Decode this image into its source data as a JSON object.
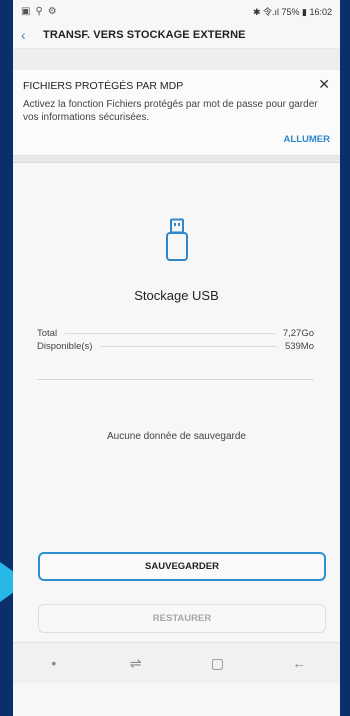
{
  "statusbar": {
    "left_icons": [
      "image-icon",
      "usb-icon",
      "network-icon"
    ],
    "right_text": "✱ 令.ıl 75% ▮ 16:02"
  },
  "appbar": {
    "title": "TRANSF. VERS STOCKAGE EXTERNE"
  },
  "notice_card": {
    "title": "FICHIERS PROTÉGÉS PAR MDP",
    "body": "Activez la fonction Fichiers protégés par mot de passe pour garder vos informations sécurisées.",
    "action": "ALLUMER"
  },
  "storage": {
    "title": "Stockage USB",
    "total_label": "Total",
    "total_value": "7,27Go",
    "available_label": "Disponible(s)",
    "available_value": "539Mo",
    "no_backup_text": "Aucune donnée de sauvegarde"
  },
  "buttons": {
    "save": "SAUVEGARDER",
    "restore": "RESTAURER"
  },
  "navbar": {
    "items": [
      "•",
      "⇌",
      "▢",
      "←"
    ]
  },
  "colors": {
    "accent": "#2f86c9",
    "outer_background": "#0b2f6b",
    "pointer": "#27b7e6"
  }
}
